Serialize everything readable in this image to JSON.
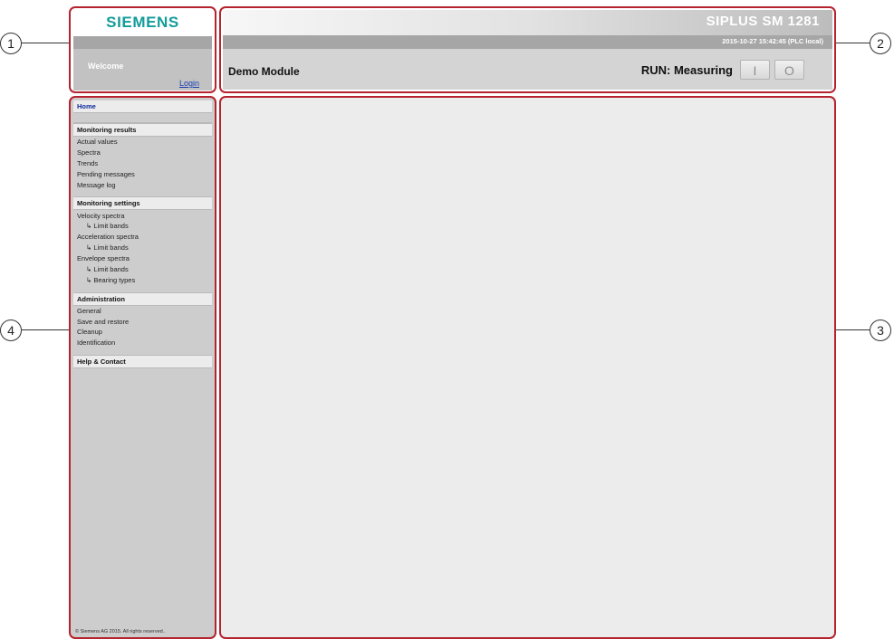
{
  "callouts": [
    "1",
    "2",
    "3",
    "4"
  ],
  "brand": {
    "logo_text": "SIEMENS",
    "logo_color": "#139c9a",
    "welcome_text": "Welcome",
    "login_link": "Login"
  },
  "header": {
    "system_name": "SIPLUS SM 1281",
    "datetime": "2015-10-27 15:42:45 (PLC local)",
    "module_name": "Demo Module",
    "run_status": "RUN: Measuring",
    "start_button_label": "I",
    "stop_button_label": "O"
  },
  "nav": {
    "home": "Home",
    "sections": [
      {
        "title": "Monitoring results",
        "items": [
          {
            "label": "Actual values"
          },
          {
            "label": "Spectra"
          },
          {
            "label": "Trends"
          },
          {
            "label": "Pending messages"
          },
          {
            "label": "Message log"
          }
        ]
      },
      {
        "title": "Monitoring settings",
        "items": [
          {
            "label": "Velocity spectra"
          },
          {
            "label": "↳ Limit bands",
            "sub": true
          },
          {
            "label": "Acceleration spectra"
          },
          {
            "label": "↳ Limit bands",
            "sub": true
          },
          {
            "label": "Envelope spectra"
          },
          {
            "label": "↳ Limit bands",
            "sub": true
          },
          {
            "label": "↳ Bearing types",
            "sub": true
          }
        ]
      },
      {
        "title": "Administration",
        "items": [
          {
            "label": "General"
          },
          {
            "label": "Save and restore"
          },
          {
            "label": "Cleanup"
          },
          {
            "label": "Identification"
          }
        ]
      },
      {
        "title": "Help & Contact",
        "items": []
      }
    ],
    "copyright": "© Siemens AG 2015. All rights reserved.."
  },
  "colors": {
    "frame": "#b5232f",
    "link": "#1a3fb2",
    "content_bg": "#ececec",
    "nav_bg": "#cdcdcd"
  }
}
